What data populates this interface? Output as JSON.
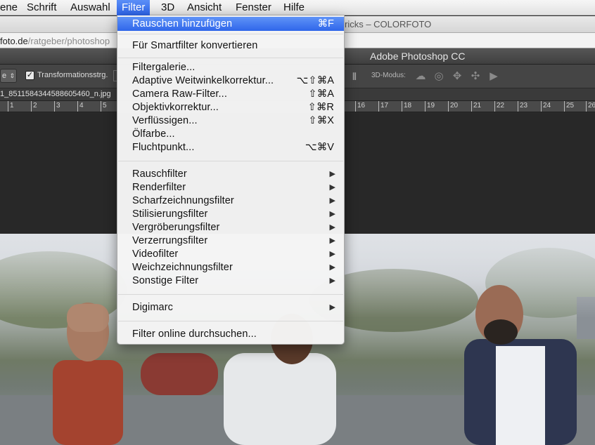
{
  "menubar": {
    "items": [
      "ene",
      "Schrift",
      "Auswahl",
      "Filter",
      "3D",
      "Ansicht",
      "Fenster",
      "Hilfe"
    ],
    "active": "Filter"
  },
  "browser": {
    "title": "ricks – COLORFOTO",
    "url_host": "foto.de",
    "url_path": "/ratgeber/photoshop"
  },
  "photoshop": {
    "app_title": "Adobe Photoshop CC",
    "options": {
      "dropdown_value": "e",
      "checkbox_label": "Transformationsstrg.",
      "checkbox_checked": true,
      "mode3d_label": "3D-Modus:"
    },
    "document_tab": "1_851158434458860546​0_n.jpg",
    "ruler_ticks": [
      "1",
      "2",
      "3",
      "4",
      "5",
      "16",
      "17",
      "18",
      "19",
      "20",
      "21",
      "22",
      "23",
      "24",
      "25",
      "26"
    ]
  },
  "filter_menu": {
    "last_filter": {
      "label": "Rauschen hinzufügen",
      "shortcut": "⌘F"
    },
    "smart_filter": "Für Smartfilter konvertieren",
    "group1": [
      {
        "label": "Filtergalerie...",
        "shortcut": ""
      },
      {
        "label": "Adaptive Weitwinkelkorrektur...",
        "shortcut": "⌥⇧⌘A"
      },
      {
        "label": "Camera Raw-Filter...",
        "shortcut": "⇧⌘A"
      },
      {
        "label": "Objektivkorrektur...",
        "shortcut": "⇧⌘R"
      },
      {
        "label": "Verflüssigen...",
        "shortcut": "⇧⌘X"
      },
      {
        "label": "Ölfarbe...",
        "shortcut": ""
      },
      {
        "label": "Fluchtpunkt...",
        "shortcut": "⌥⌘V"
      }
    ],
    "submenus": [
      "Rauschfilter",
      "Renderfilter",
      "Scharfzeichnungsfilter",
      "Stilisierungsfilter",
      "Vergröberungsfilter",
      "Verzerrungsfilter",
      "Videofilter",
      "Weichzeichnungsfilter",
      "Sonstige Filter"
    ],
    "digimarc": "Digimarc",
    "browse_online": "Filter online durchsuchen...",
    "submenu_arrow": "▶"
  }
}
